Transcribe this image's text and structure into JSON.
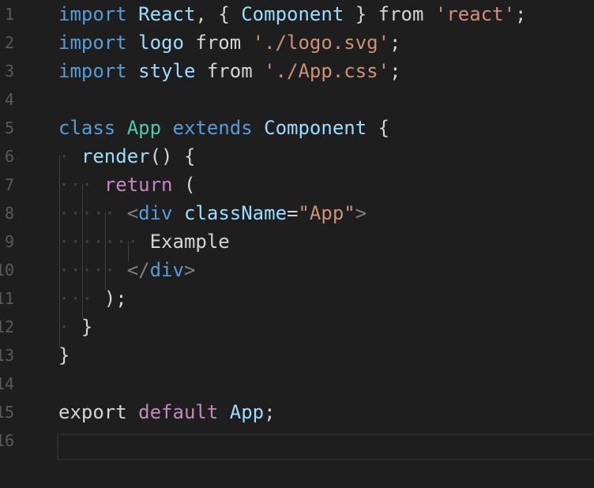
{
  "editor": {
    "language": "javascript",
    "current_line": "16",
    "lines": [
      {
        "num": "1"
      },
      {
        "num": "2"
      },
      {
        "num": "3"
      },
      {
        "num": "4"
      },
      {
        "num": "5"
      },
      {
        "num": "6"
      },
      {
        "num": "7"
      },
      {
        "num": "8"
      },
      {
        "num": "9"
      },
      {
        "num": "10"
      },
      {
        "num": "11"
      },
      {
        "num": "12"
      },
      {
        "num": "13"
      },
      {
        "num": "14"
      },
      {
        "num": "15"
      },
      {
        "num": "16"
      }
    ]
  },
  "code": {
    "l1": {
      "import": "import",
      "react": "React",
      "comma": ",",
      "lb": "{",
      "component": "Component",
      "rb": "}",
      "from": "from",
      "str": "'react'",
      "semi": ";"
    },
    "l2": {
      "import": "import",
      "logo": "logo",
      "from": "from",
      "str": "'./logo.svg'",
      "semi": ";"
    },
    "l3": {
      "import": "import",
      "style": "style",
      "from": "from",
      "str": "'./App.css'",
      "semi": ";"
    },
    "l5": {
      "class": "class",
      "name": "App",
      "extends": "extends",
      "base": "Component",
      "brace": "{"
    },
    "l6": {
      "method": "render",
      "parens": "()",
      "brace": "{"
    },
    "l7": {
      "return": "return",
      "paren": "("
    },
    "l8": {
      "open": "<",
      "tag": "div",
      "attr": "className",
      "eq": "=",
      "val": "\"App\"",
      "close": ">"
    },
    "l9": {
      "text": "Example"
    },
    "l10": {
      "open": "</",
      "tag": "div",
      "close": ">"
    },
    "l11": {
      "text": ");"
    },
    "l12": {
      "text": "}"
    },
    "l13": {
      "text": "}"
    },
    "l15": {
      "export": "export",
      "default": "default",
      "name": "App",
      "semi": ";"
    }
  },
  "colors": {
    "background": "#1e1e1e",
    "keyword_control": "#c586c0",
    "keyword_storage": "#569cd6",
    "class_name": "#4ec9b0",
    "identifier": "#9cdcfe",
    "string": "#ce9178",
    "gutter": "#5a5a5a"
  }
}
